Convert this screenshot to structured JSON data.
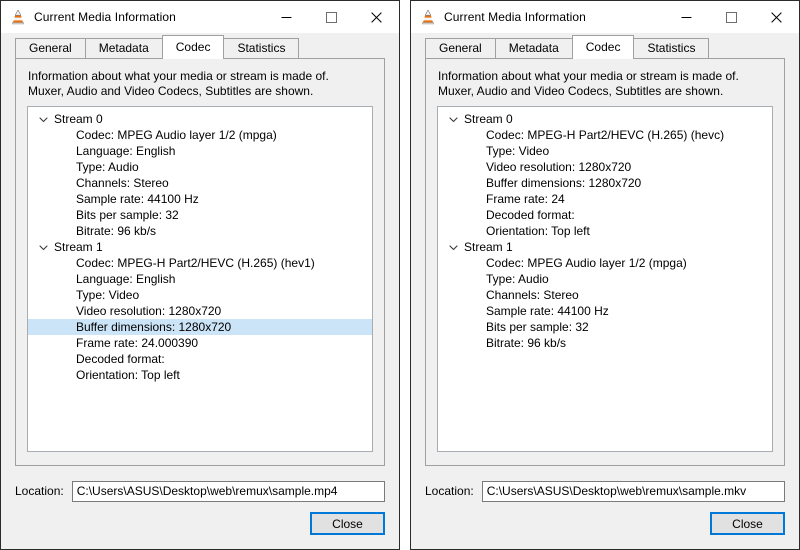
{
  "windows": [
    {
      "title": "Current Media Information",
      "icon": "vlc-cone-icon",
      "controls": {
        "minimize": "minimize-icon",
        "maximize": "maximize-icon",
        "close": "close-icon"
      },
      "tabs": [
        {
          "label": "General",
          "active": false
        },
        {
          "label": "Metadata",
          "active": false
        },
        {
          "label": "Codec",
          "active": true
        },
        {
          "label": "Statistics",
          "active": false
        }
      ],
      "intro": "Information about what your media or stream is made of.\nMuxer, Audio and Video Codecs, Subtitles are shown.",
      "streams": [
        {
          "name": "Stream 0",
          "expanded": true,
          "rows": [
            {
              "text": "Codec: MPEG Audio layer 1/2 (mpga)",
              "selected": false
            },
            {
              "text": "Language: English",
              "selected": false
            },
            {
              "text": "Type: Audio",
              "selected": false
            },
            {
              "text": "Channels: Stereo",
              "selected": false
            },
            {
              "text": "Sample rate: 44100 Hz",
              "selected": false
            },
            {
              "text": "Bits per sample: 32",
              "selected": false
            },
            {
              "text": "Bitrate: 96 kb/s",
              "selected": false
            }
          ]
        },
        {
          "name": "Stream 1",
          "expanded": true,
          "rows": [
            {
              "text": "Codec: MPEG-H Part2/HEVC (H.265) (hev1)",
              "selected": false
            },
            {
              "text": "Language: English",
              "selected": false
            },
            {
              "text": "Type: Video",
              "selected": false
            },
            {
              "text": "Video resolution: 1280x720",
              "selected": false
            },
            {
              "text": "Buffer dimensions: 1280x720",
              "selected": true
            },
            {
              "text": "Frame rate: 24.000390",
              "selected": false
            },
            {
              "text": "Decoded format:",
              "selected": false
            },
            {
              "text": "Orientation: Top left",
              "selected": false
            }
          ]
        }
      ],
      "location_label": "Location:",
      "location_value": "C:\\Users\\ASUS\\Desktop\\web\\remux\\sample.mp4",
      "close_label": "Close"
    },
    {
      "title": "Current Media Information",
      "icon": "vlc-cone-icon",
      "controls": {
        "minimize": "minimize-icon",
        "maximize": "maximize-icon",
        "close": "close-icon"
      },
      "tabs": [
        {
          "label": "General",
          "active": false
        },
        {
          "label": "Metadata",
          "active": false
        },
        {
          "label": "Codec",
          "active": true
        },
        {
          "label": "Statistics",
          "active": false
        }
      ],
      "intro": "Information about what your media or stream is made of.\nMuxer, Audio and Video Codecs, Subtitles are shown.",
      "streams": [
        {
          "name": "Stream 0",
          "expanded": true,
          "rows": [
            {
              "text": "Codec: MPEG-H Part2/HEVC (H.265) (hevc)",
              "selected": false
            },
            {
              "text": "Type: Video",
              "selected": false
            },
            {
              "text": "Video resolution: 1280x720",
              "selected": false
            },
            {
              "text": "Buffer dimensions: 1280x720",
              "selected": false
            },
            {
              "text": "Frame rate: 24",
              "selected": false
            },
            {
              "text": "Decoded format:",
              "selected": false
            },
            {
              "text": "Orientation: Top left",
              "selected": false
            }
          ]
        },
        {
          "name": "Stream 1",
          "expanded": true,
          "rows": [
            {
              "text": "Codec: MPEG Audio layer 1/2 (mpga)",
              "selected": false
            },
            {
              "text": "Type: Audio",
              "selected": false
            },
            {
              "text": "Channels: Stereo",
              "selected": false
            },
            {
              "text": "Sample rate: 44100 Hz",
              "selected": false
            },
            {
              "text": "Bits per sample: 32",
              "selected": false
            },
            {
              "text": "Bitrate: 96 kb/s",
              "selected": false
            }
          ]
        }
      ],
      "location_label": "Location:",
      "location_value": "C:\\Users\\ASUS\\Desktop\\web\\remux\\sample.mkv",
      "close_label": "Close"
    }
  ],
  "colors": {
    "selection": "#cce4f7",
    "focus_border": "#0078d7",
    "window_bg": "#f0f0f0",
    "cone_orange": "#e8700f"
  }
}
